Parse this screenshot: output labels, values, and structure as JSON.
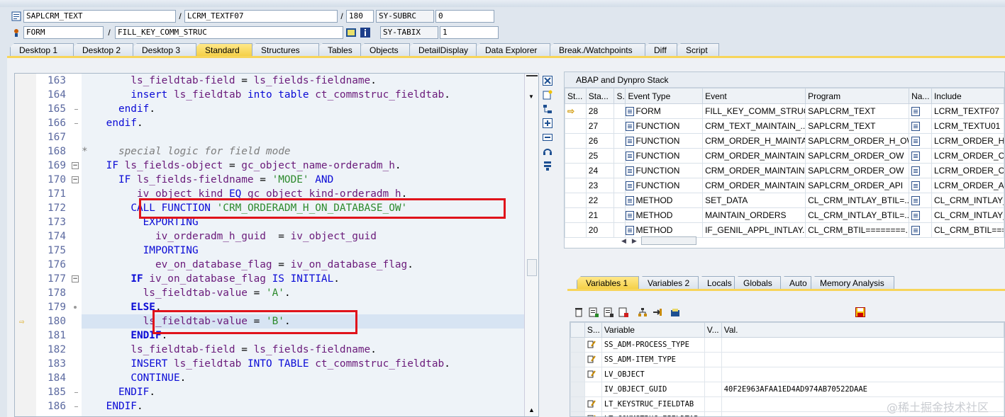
{
  "header": {
    "row1": {
      "program": "SAPLCRM_TEXT",
      "include": "LCRM_TEXTF07",
      "line": "180",
      "sys_label": "SY-SUBRC",
      "sys_value": "0"
    },
    "row2": {
      "type": "FORM",
      "name": "FILL_KEY_COMM_STRUC",
      "sys_label": "SY-TABIX",
      "sys_value": "1"
    }
  },
  "tabs": [
    "Desktop 1",
    "Desktop 2",
    "Desktop 3",
    "Standard",
    "Structures",
    "Tables",
    "Objects",
    "DetailDisplay",
    "Data Explorer",
    "Break./Watchpoints",
    "Diff",
    "Script"
  ],
  "active_tab": "Standard",
  "code_lines": [
    {
      "num": "163",
      "html": "        <span class=\"var\">ls_fieldtab-field</span> = <span class=\"var\">ls_fields-fieldname</span>."
    },
    {
      "num": "164",
      "html": "        <span class=\"kw\">insert</span> <span class=\"var\">ls_fieldtab</span> <span class=\"kw\">into table</span> <span class=\"var\">ct_commstruc_fieldtab</span>."
    },
    {
      "num": "165",
      "html": "      <span class=\"kw\">endif</span>."
    },
    {
      "num": "166",
      "html": "    <span class=\"kw\">endif</span>."
    },
    {
      "num": "167",
      "html": ""
    },
    {
      "num": "168",
      "html": "<span class=\"cmt\">*     special logic for field mode</span>"
    },
    {
      "num": "169",
      "html": "    <span class=\"kw\">IF</span> <span class=\"var\">ls_fields-object</span> = <span class=\"var\">gc_object_name-orderadm_h</span>."
    },
    {
      "num": "170",
      "html": "      <span class=\"kw\">IF</span> <span class=\"var\">ls_fields-fieldname</span> = <span class=\"str\">'MODE'</span> <span class=\"kw\">AND</span>"
    },
    {
      "num": "171",
      "html": "         <span class=\"var\">iv_object_kind</span> <span class=\"kw\">EQ</span> <span class=\"var\">gc_object_kind-orderadm_h</span>."
    },
    {
      "num": "172",
      "html": "        <span class=\"kw\">CALL FUNCTION</span> <span class=\"str\">'CRM_ORDERADM_H_ON_DATABASE_OW'</span>"
    },
    {
      "num": "173",
      "html": "          <span class=\"kw\">EXPORTING</span>"
    },
    {
      "num": "174",
      "html": "            <span class=\"var\">iv_orderadm_h_guid</span>  = <span class=\"var\">iv_object_guid</span>"
    },
    {
      "num": "175",
      "html": "          <span class=\"kw\">IMPORTING</span>"
    },
    {
      "num": "176",
      "html": "            <span class=\"var\">ev_on_database_flag</span> = <span class=\"var\">iv_on_database_flag</span>."
    },
    {
      "num": "177",
      "html": "        <span class=\"kwb\">IF</span> <span class=\"var\">iv_on_database_flag</span> <span class=\"kw\">IS INITIAL</span>."
    },
    {
      "num": "178",
      "html": "          <span class=\"var\">ls_fieldtab-value</span> = <span class=\"str\">'A'</span>."
    },
    {
      "num": "179",
      "html": "        <span class=\"kwb\">ELSE</span>."
    },
    {
      "num": "180",
      "html": "          <span class=\"var\">ls_fieldtab-value</span> = <span class=\"str\">'B'</span>."
    },
    {
      "num": "181",
      "html": "        <span class=\"kwb\">ENDIF</span>."
    },
    {
      "num": "182",
      "html": "        <span class=\"var\">ls_fieldtab-field</span> = <span class=\"var\">ls_fields-fieldname</span>."
    },
    {
      "num": "183",
      "html": "        <span class=\"kw\">INSERT</span> <span class=\"var\">ls_fieldtab</span> <span class=\"kw\">INTO TABLE</span> <span class=\"var\">ct_commstruc_fieldtab</span>."
    },
    {
      "num": "184",
      "html": "        <span class=\"kw\">CONTINUE</span>."
    },
    {
      "num": "185",
      "html": "      <span class=\"kw\">ENDIF</span>."
    },
    {
      "num": "186",
      "html": "    <span class=\"kw\">ENDIF</span>."
    }
  ],
  "current_line": "180",
  "stack": {
    "title": "ABAP and Dynpro Stack",
    "columns": [
      "St...",
      "Sta...",
      "S...",
      "Event Type",
      "Event",
      "Program",
      "Na...",
      "Include"
    ],
    "rows": [
      {
        "level": "28",
        "type": "FORM",
        "event": "FILL_KEY_COMM_STRUC",
        "program": "SAPLCRM_TEXT",
        "include": "LCRM_TEXTF07",
        "current": true
      },
      {
        "level": "27",
        "type": "FUNCTION",
        "event": "CRM_TEXT_MAINTAIN_...",
        "program": "SAPLCRM_TEXT",
        "include": "LCRM_TEXTU01",
        "current": false
      },
      {
        "level": "26",
        "type": "FUNCTION",
        "event": "CRM_ORDER_H_MAINTA...",
        "program": "SAPLCRM_ORDER_H_OW",
        "include": "LCRM_ORDER_H_...",
        "current": false
      },
      {
        "level": "25",
        "type": "FUNCTION",
        "event": "CRM_ORDER_MAINTAIN...",
        "program": "SAPLCRM_ORDER_OW",
        "include": "LCRM_ORDER_OW...",
        "current": false
      },
      {
        "level": "24",
        "type": "FUNCTION",
        "event": "CRM_ORDER_MAINTAIN...",
        "program": "SAPLCRM_ORDER_OW",
        "include": "LCRM_ORDER_OW...",
        "current": false
      },
      {
        "level": "23",
        "type": "FUNCTION",
        "event": "CRM_ORDER_MAINTAIN",
        "program": "SAPLCRM_ORDER_API",
        "include": "LCRM_ORDER_AP...",
        "current": false
      },
      {
        "level": "22",
        "type": "METHOD",
        "event": "SET_DATA",
        "program": "CL_CRM_INTLAY_BTIL=...",
        "include": "CL_CRM_INTLAY_...",
        "current": false
      },
      {
        "level": "21",
        "type": "METHOD",
        "event": "MAINTAIN_ORDERS",
        "program": "CL_CRM_INTLAY_BTIL=...",
        "include": "CL_CRM_INTLAY_...",
        "current": false
      },
      {
        "level": "20",
        "type": "METHOD",
        "event": "IF_GENIL_APPL_INTLAY...",
        "program": "CL_CRM_BTIL========...",
        "include": "CL_CRM_BTIL===...",
        "current": false
      }
    ]
  },
  "var_tabs": [
    "Variables 1",
    "Variables 2",
    "Locals",
    "Globals",
    "Auto",
    "Memory Analysis"
  ],
  "active_var_tab": "Variables 1",
  "vars": {
    "columns": [
      "S...",
      "Variable",
      "V...",
      "Val."
    ],
    "rows": [
      {
        "name": "SS_ADM-PROCESS_TYPE",
        "value": "",
        "icon": true
      },
      {
        "name": "SS_ADM-ITEM_TYPE",
        "value": "",
        "icon": true
      },
      {
        "name": "LV_OBJECT",
        "value": "",
        "icon": true
      },
      {
        "name": "IV_OBJECT_GUID",
        "value": "40F2E963AFAA1ED4AD974AB70522DAAE",
        "icon": false
      },
      {
        "name": "LT_KEYSTRUC_FIELDTAB",
        "value": "",
        "icon": true
      },
      {
        "name": "LT_COMMSTRUC_FIELDTAB",
        "value": "",
        "icon": true
      }
    ]
  },
  "watermark": "@稀土掘金技术社区",
  "colors": {
    "accent_tab": "#f4cf45",
    "highlight_box": "#e0131b"
  }
}
